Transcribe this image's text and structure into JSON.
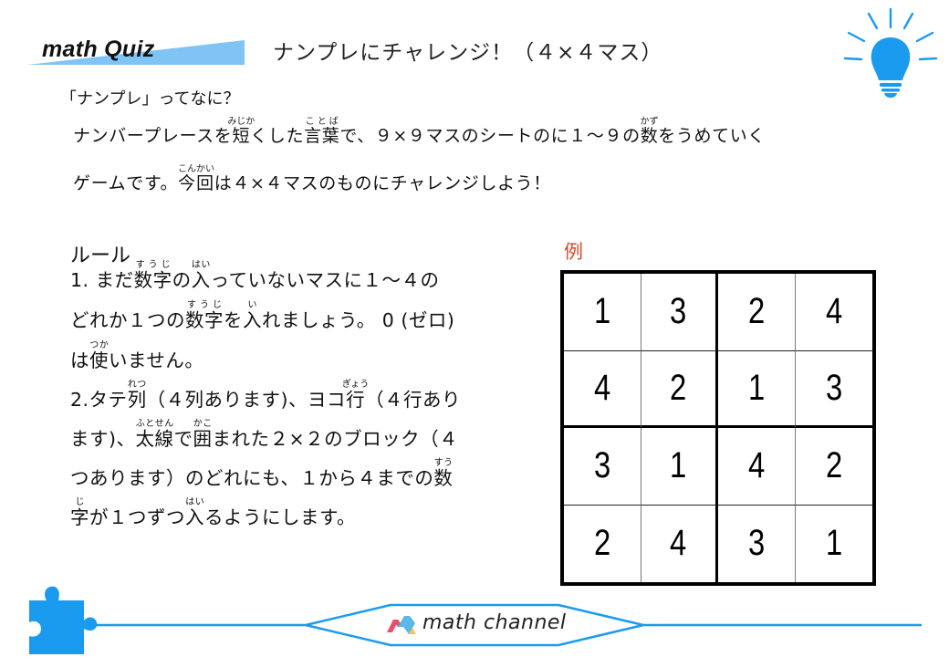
{
  "header": {
    "brand": "math Quiz",
    "title": "ナンプレにチャレンジ！（４×４マス）",
    "accent_color": "#1a9bf0",
    "wedge_color": "#7fc4f5"
  },
  "intro": {
    "heading": "「ナンプレ」ってなに？",
    "line1": {
      "t1": "ナンバープレースを",
      "r1_base": "短",
      "r1_ruby": "みじか",
      "t2": "くした",
      "r2_base": "言葉",
      "r2_ruby": "ことば",
      "t3": "で、９×９マスのシートのに１～９の",
      "r3_base": "数",
      "r3_ruby": "かず",
      "t4": "をうめていく"
    },
    "line2": {
      "t1": "ゲームです。",
      "r1_base": "今回",
      "r1_ruby": "こんかい",
      "t2": "は４×４マスのものにチャレンジしよう！"
    }
  },
  "rules": {
    "heading": "ルール",
    "l1": {
      "t1": "1. まだ",
      "r1_base": "数字",
      "r1_ruby": "すうじ",
      "t2": "の",
      "r2_base": "入",
      "r2_ruby": "はい",
      "t3": "っていないマスに１～４の"
    },
    "l2": {
      "t1": "どれか１つの",
      "r1_base": "数字",
      "r1_ruby": "すうじ",
      "t2": "を",
      "r2_base": "入",
      "r2_ruby": "い",
      "t3": "れましょう。 0 (ゼロ)"
    },
    "l3": {
      "t1": "は",
      "r1_base": "使",
      "r1_ruby": "つか",
      "t2": "いません。"
    },
    "l4": {
      "t1": "2.タテ",
      "r1_base": "列",
      "r1_ruby": "れつ",
      "t2": "（４列あります)、ヨコ",
      "r2_base": "行",
      "r2_ruby": "ぎょう",
      "t3": "（４行あり"
    },
    "l5": {
      "t1": "ます)、",
      "r1_base": "太線",
      "r1_ruby": "ふとせん",
      "t2": "で",
      "r2_base": "囲",
      "r2_ruby": "かこ",
      "t3": "まれた２×２のブロック（４"
    },
    "l6": {
      "t1": "つあります）のどれにも、１から４までの",
      "r1_base": "数",
      "r1_ruby": "すう"
    },
    "l7": {
      "r1_base": "字",
      "r1_ruby": "じ",
      "t1": "が１つずつ",
      "r2_base": "入",
      "r2_ruby": "はい",
      "t2": "るようにします。"
    }
  },
  "example": {
    "label": "例",
    "label_color": "#d9482b",
    "grid": [
      [
        "1",
        "3",
        "2",
        "4"
      ],
      [
        "4",
        "2",
        "1",
        "3"
      ],
      [
        "3",
        "1",
        "4",
        "2"
      ],
      [
        "2",
        "4",
        "3",
        "1"
      ]
    ]
  },
  "footer": {
    "brand": "math channel",
    "icons": [
      "puzzle-piece-icon",
      "math-channel-logo-icon"
    ]
  }
}
